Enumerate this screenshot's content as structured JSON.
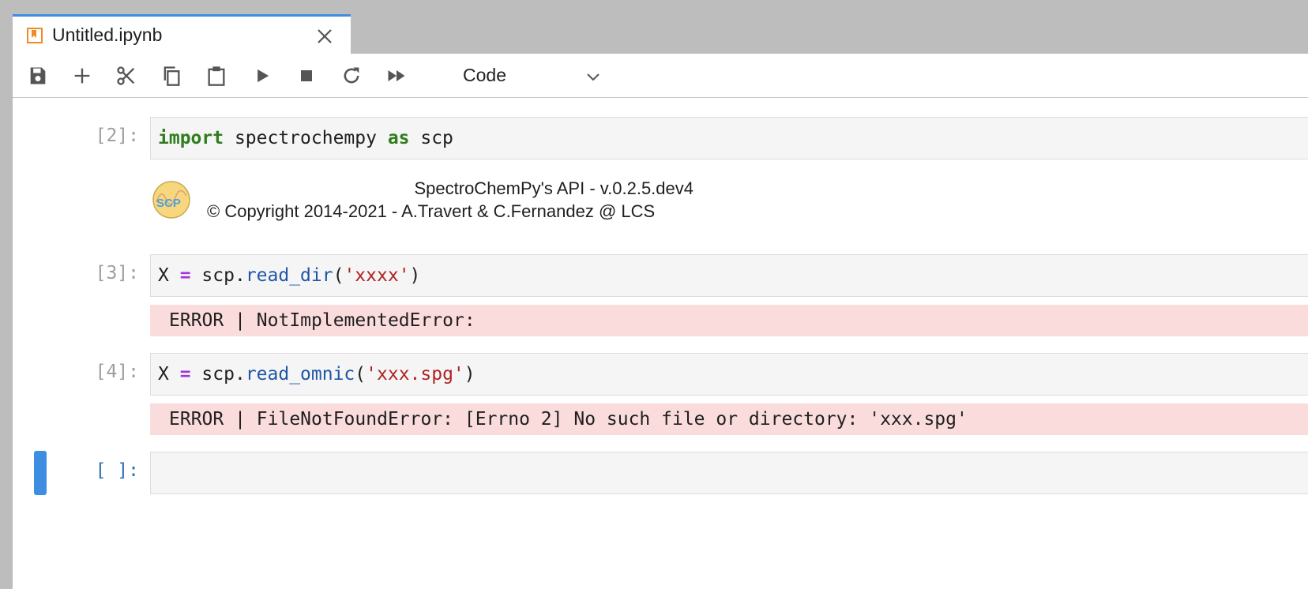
{
  "tab": {
    "title": "Untitled.ipynb",
    "icon": "notebook-icon",
    "accent": "#f08a24"
  },
  "toolbar": {
    "buttons": [
      "save-icon",
      "plus-icon",
      "cut-icon",
      "copy-icon",
      "paste-icon",
      "run-icon",
      "stop-icon",
      "restart-icon",
      "fast-forward-icon"
    ],
    "cell_type": "Code"
  },
  "cells": [
    {
      "prompt": "[2]:",
      "code": [
        {
          "t": "import",
          "c": "kw"
        },
        {
          "t": " spectrochempy ",
          "c": ""
        },
        {
          "t": "as",
          "c": "kw"
        },
        {
          "t": " scp",
          "c": ""
        }
      ],
      "output": {
        "type": "logo-text",
        "logo_text": "SCP",
        "line1": "SpectroChemPy's API - v.0.2.5.dev4",
        "line2": "© Copyright 2014-2021 - A.Travert & C.Fernandez @ LCS"
      }
    },
    {
      "prompt": "[3]:",
      "code": [
        {
          "t": "X ",
          "c": ""
        },
        {
          "t": "=",
          "c": "op"
        },
        {
          "t": " scp.",
          "c": ""
        },
        {
          "t": "read_dir",
          "c": "fn"
        },
        {
          "t": "(",
          "c": ""
        },
        {
          "t": "'xxxx'",
          "c": "str"
        },
        {
          "t": ")",
          "c": ""
        }
      ],
      "output": {
        "type": "error",
        "text": "ERROR | NotImplementedError:"
      }
    },
    {
      "prompt": "[4]:",
      "code": [
        {
          "t": "X ",
          "c": ""
        },
        {
          "t": "=",
          "c": "op"
        },
        {
          "t": " scp.",
          "c": ""
        },
        {
          "t": "read_omnic",
          "c": "fn"
        },
        {
          "t": "(",
          "c": ""
        },
        {
          "t": "'xxx.spg'",
          "c": "str"
        },
        {
          "t": ")",
          "c": ""
        }
      ],
      "output": {
        "type": "error",
        "text": "ERROR | FileNotFoundError: [Errno 2] No such file or directory: 'xxx.spg'"
      }
    },
    {
      "prompt": "[ ]:",
      "code": [],
      "active": true
    }
  ],
  "colors": {
    "active": "#3d8ee0",
    "error_bg": "#fadcdc",
    "keyword": "#2f7d1d",
    "operator": "#a134d8",
    "function": "#1f55a6",
    "string": "#b02222"
  }
}
